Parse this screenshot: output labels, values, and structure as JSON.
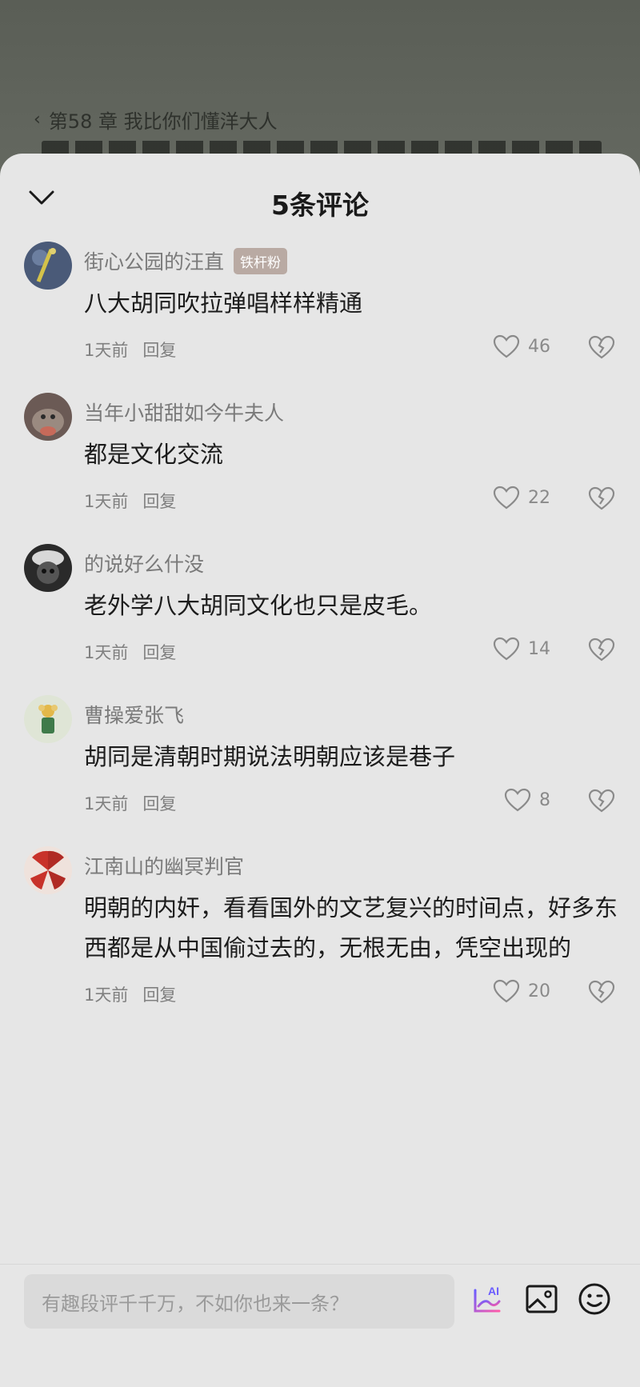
{
  "background": {
    "chapter_label": "第58 章  我比你们懂洋大人"
  },
  "sheet": {
    "title": "5条评论"
  },
  "comments": [
    {
      "username": "街心公园的汪直",
      "badge": "铁杆粉",
      "text": "八大胡同吹拉弹唱样样精通",
      "time": "1天前",
      "reply_label": "回复",
      "likes": "46"
    },
    {
      "username": "当年小甜甜如今牛夫人",
      "badge": "",
      "text": "都是文化交流",
      "time": "1天前",
      "reply_label": "回复",
      "likes": "22"
    },
    {
      "username": "的说好么什没",
      "badge": "",
      "text": "老外学八大胡同文化也只是皮毛。",
      "time": "1天前",
      "reply_label": "回复",
      "likes": "14"
    },
    {
      "username": "曹操爱张飞",
      "badge": "",
      "text": "胡同是清朝时期说法明朝应该是巷子",
      "time": "1天前",
      "reply_label": "回复",
      "likes": "8"
    },
    {
      "username": "江南山的幽冥判官",
      "badge": "",
      "text": "明朝的内奸，看看国外的文艺复兴的时间点，好多东西都是从中国偷过去的，无根无由，凭空出现的",
      "time": "1天前",
      "reply_label": "回复",
      "likes": "20"
    }
  ],
  "input": {
    "placeholder": "有趣段评千千万，不如你也来一条？"
  },
  "icons": {
    "collapse": "chevron-down-icon",
    "like": "heart-outline-icon",
    "dislike": "broken-heart-icon",
    "ai": "ai-icon",
    "image": "image-icon",
    "emoji": "emoji-icon"
  },
  "colors": {
    "sheet_bg": "#e6e6e6",
    "badge_bg": "#b9aaa3",
    "text_primary": "#1c1c1c",
    "text_secondary": "#7a7a7a"
  }
}
